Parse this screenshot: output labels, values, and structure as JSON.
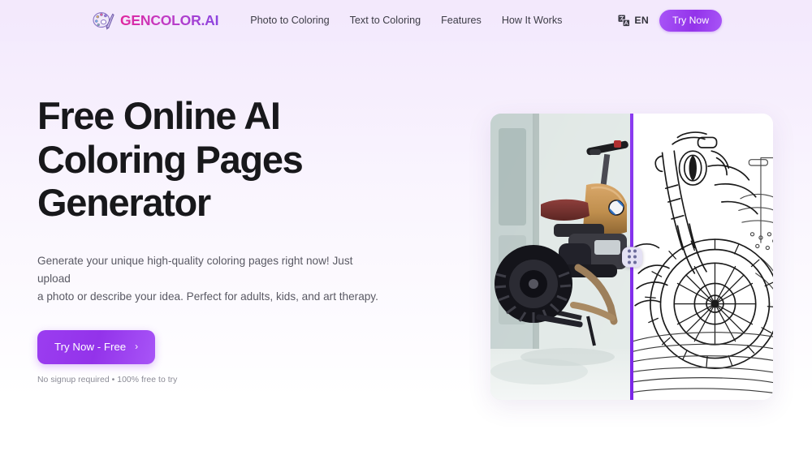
{
  "header": {
    "brand": {
      "name": "GENCOLOR.AI",
      "icon": "palette-brush-icon"
    },
    "nav": [
      {
        "label": "Photo to Coloring"
      },
      {
        "label": "Text to Coloring"
      },
      {
        "label": "Features"
      },
      {
        "label": "How It Works"
      }
    ],
    "language": {
      "icon": "translate-icon",
      "code": "EN"
    },
    "cta": {
      "label": "Try Now"
    }
  },
  "hero": {
    "title_lines": [
      "Free Online AI",
      "Coloring Pages",
      "Generator"
    ],
    "subtitle_lines": [
      "Generate your unique high-quality coloring pages right now! Just upload",
      "a photo or describe your idea. Perfect for adults, kids, and art therapy."
    ],
    "cta": {
      "label": "Try Now - Free",
      "arrow": "›"
    },
    "note": "No signup required • 100% free to try"
  },
  "comparison": {
    "before_alt": "photo of a BMW scrambler motorcycle by a window",
    "after_alt": "black and white line-art coloring page of the motorcycle",
    "handle_icon": "drag-handle-dots-icon",
    "divider_position_percent": 50
  },
  "colors": {
    "brand_gradient_start": "#e0279e",
    "brand_gradient_end": "#8b44e0",
    "accent_purple": "#9333ea",
    "divider_purple": "#8b3cf0",
    "page_bg_top": "#f3e9fc",
    "page_bg_bottom": "#ffffff",
    "title_text": "#18181b",
    "body_text": "#595963",
    "note_text": "#8b8b96"
  }
}
